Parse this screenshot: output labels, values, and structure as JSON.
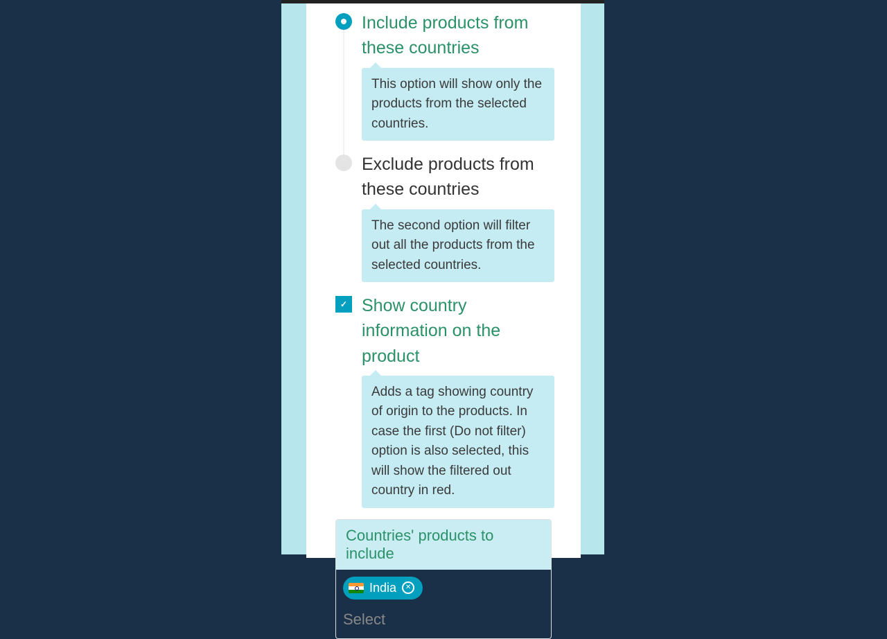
{
  "options": {
    "include": {
      "label": "Include products from these countries",
      "info": "This option will show only the products from the selected countries.",
      "selected": true
    },
    "exclude": {
      "label": "Exclude products from these countries",
      "info": "The second option will filter out all the products from the selected countries.",
      "selected": false
    },
    "show_country_info": {
      "label": "Show country information on the product",
      "info": "Adds a tag showing country of origin to the products. In case the first (Do not filter) option is also selected, this will show the filtered out country in red.",
      "checked": true
    }
  },
  "countries_section": {
    "header": "Countries' products to include",
    "chips": [
      {
        "name": "India",
        "flag": "in"
      }
    ],
    "placeholder": "Select"
  },
  "colors": {
    "accent": "#029fbe",
    "label_active": "#2a9168",
    "info_bg": "#c5ecf2"
  }
}
